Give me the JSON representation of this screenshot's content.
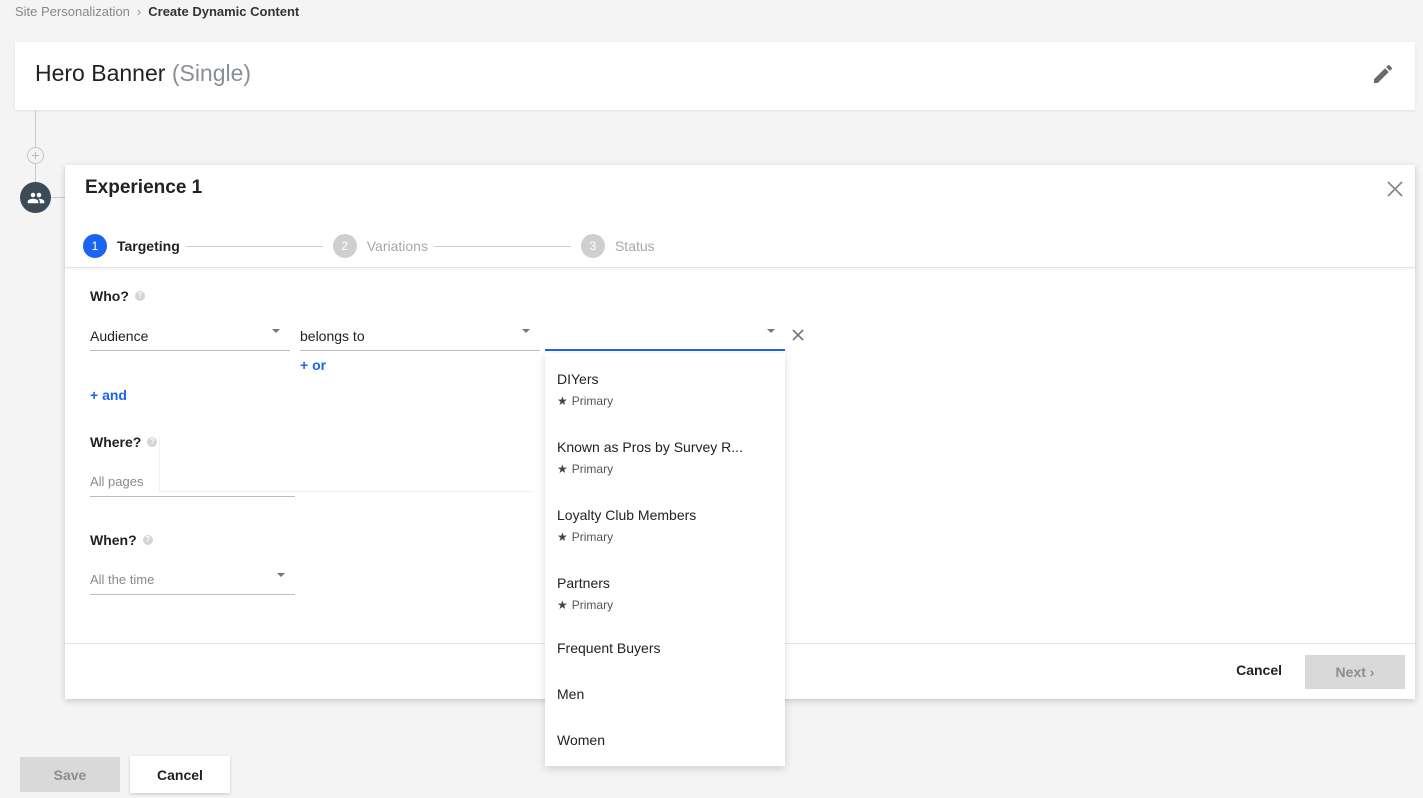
{
  "breadcrumb": {
    "parent": "Site Personalization",
    "separator": "›",
    "current": "Create Dynamic Content"
  },
  "header": {
    "title": "Hero Banner",
    "subtitle": "(Single)"
  },
  "experience": {
    "title": "Experience 1",
    "steps": [
      {
        "num": "1",
        "label": "Targeting",
        "active": true
      },
      {
        "num": "2",
        "label": "Variations",
        "active": false
      },
      {
        "num": "3",
        "label": "Status",
        "active": false
      }
    ],
    "who": {
      "label": "Who?",
      "attribute": "Audience",
      "operator": "belongs to",
      "value": "",
      "or_link": "+ or",
      "and_link": "+ and"
    },
    "where": {
      "label": "Where?",
      "placeholder": "All pages"
    },
    "when": {
      "label": "When?",
      "value": "All the time"
    },
    "footer": {
      "cancel": "Cancel",
      "next": "Next ›"
    }
  },
  "audience_dropdown": [
    {
      "name": "DIYers",
      "sub": "Primary"
    },
    {
      "name": "Known as Pros by Survey R...",
      "sub": "Primary"
    },
    {
      "name": "Loyalty Club Members",
      "sub": "Primary"
    },
    {
      "name": "Partners",
      "sub": "Primary"
    },
    {
      "name": "Frequent Buyers",
      "sub": ""
    },
    {
      "name": "Men",
      "sub": ""
    },
    {
      "name": "Women",
      "sub": ""
    }
  ],
  "page_actions": {
    "save": "Save",
    "cancel": "Cancel"
  },
  "colors": {
    "accent": "#1a64f0",
    "node": "#3d4b57",
    "disabled_button": "#d9d9d9"
  },
  "icons": [
    "edit-pencil-icon",
    "close-icon",
    "audience-people-icon",
    "add-circle-icon",
    "help-icon",
    "star-icon",
    "clear-x-icon",
    "chevron-down-icon"
  ]
}
